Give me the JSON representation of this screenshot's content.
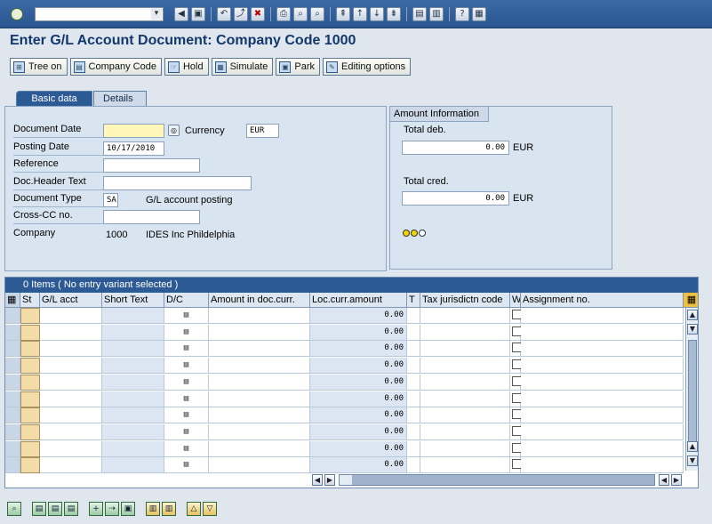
{
  "system_toolbar": {
    "command_dropdown_glyph": "▾",
    "icons": [
      "enter-icon",
      "back-icon",
      "exit-icon",
      "cancel-icon",
      "print-icon",
      "find-icon",
      "find-next-icon",
      "first-page-icon",
      "previous-page-icon",
      "next-page-icon",
      "last-page-icon",
      "create-session-icon",
      "shortcut-icon",
      "help-icon",
      "layout-menu-icon"
    ]
  },
  "title": "Enter G/L Account Document: Company Code 1000",
  "app_toolbar": {
    "tree_on": "Tree on",
    "company_code": "Company Code",
    "hold": "Hold",
    "simulate": "Simulate",
    "park": "Park",
    "editing_options": "Editing options"
  },
  "tabs": {
    "basic_data": "Basic data",
    "details": "Details"
  },
  "basic_data": {
    "document_date_label": "Document Date",
    "document_date_value": "",
    "currency_label": "Currency",
    "currency_value": "EUR",
    "posting_date_label": "Posting Date",
    "posting_date_value": "10/17/2010",
    "reference_label": "Reference",
    "reference_value": "",
    "doc_header_label": "Doc.Header Text",
    "doc_header_value": "",
    "document_type_label": "Document Type",
    "document_type_value": "SA",
    "document_type_text": "G/L account posting",
    "cross_cc_label": "Cross-CC no.",
    "cross_cc_value": "",
    "company_label": "Company",
    "company_code": "1000",
    "company_name": "IDES Inc Phildelphia"
  },
  "amount_info": {
    "heading": "Amount Information",
    "total_debit_label": "Total deb.",
    "total_debit_value": "0.00",
    "total_debit_currency": "EUR",
    "total_credit_label": "Total cred.",
    "total_credit_value": "0.00",
    "total_credit_currency": "EUR"
  },
  "items_table": {
    "caption": "0 Items ( No entry variant selected )",
    "columns": {
      "st": "St",
      "gl_acct": "G/L acct",
      "short_text": "Short Text",
      "dc": "D/C",
      "amount_doc": "Amount in doc.curr.",
      "loc_curr": "Loc.curr.amount",
      "t": "T",
      "tax": "Tax jurisdictn code",
      "w": "W",
      "assignment": "Assignment no."
    },
    "rows": [
      {
        "loc_amount": "0.00"
      },
      {
        "loc_amount": "0.00"
      },
      {
        "loc_amount": "0.00"
      },
      {
        "loc_amount": "0.00"
      },
      {
        "loc_amount": "0.00"
      },
      {
        "loc_amount": "0.00"
      },
      {
        "loc_amount": "0.00"
      },
      {
        "loc_amount": "0.00"
      },
      {
        "loc_amount": "0.00"
      },
      {
        "loc_amount": "0.00"
      }
    ]
  },
  "bottom_toolbar": {
    "icons": [
      "details-icon",
      "first-row-icon",
      "previous-row-icon",
      "next-row-icon",
      "insert-row-icon",
      "delete-row-icon",
      "copy-row-icon",
      "multi-copy-icon",
      "select-all-icon",
      "deselect-icon",
      "sort-icon",
      "filter-icon"
    ]
  }
}
